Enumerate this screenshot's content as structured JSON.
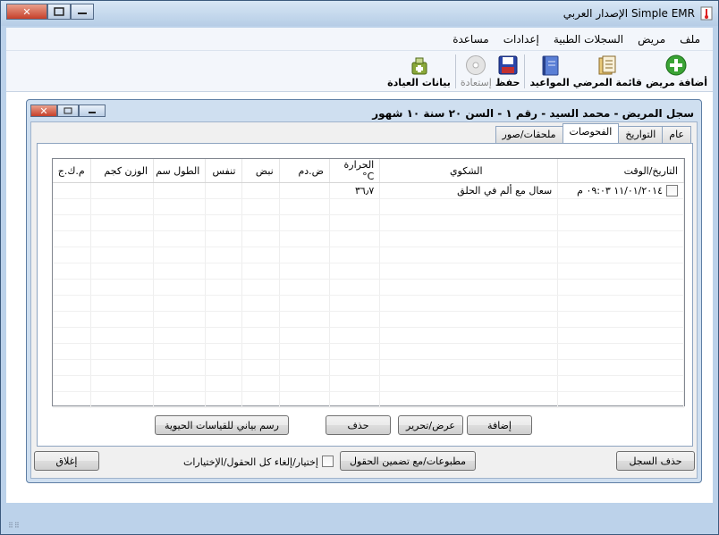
{
  "window": {
    "title": "Simple EMR الإصدار العربي",
    "controls": {
      "minimize": "",
      "maximize": "",
      "close": "✕"
    }
  },
  "menu": [
    "ملف",
    "مريض",
    "السجلات الطبية",
    "إعدادات",
    "مساعدة"
  ],
  "toolbar": {
    "items": [
      {
        "label": "أضافة مريض",
        "icon": "add-patient-icon"
      },
      {
        "label": "قائمة المرضي",
        "icon": "patient-list-icon"
      },
      {
        "label": "المواعيد",
        "icon": "appointments-icon"
      },
      {
        "label": "حفظ",
        "icon": "save-icon"
      },
      {
        "label": "إستعادة",
        "icon": "restore-icon",
        "disabled": true
      },
      {
        "label": "بيانات العيادة",
        "icon": "clinic-data-icon"
      }
    ]
  },
  "record": {
    "title": "سجل المريض - محمد السيد - رقم ١ - السن ٢٠ سنة ١٠ شهور",
    "tabs": [
      "عام",
      "التواريخ",
      "الفحوصات",
      "ملحقات/صور"
    ],
    "active_tab": 2,
    "table": {
      "columns": [
        "التاريخ/الوقت",
        "الشكوي",
        "الحرارة C°",
        "ض.دم",
        "نبض",
        "تنفس",
        "الطول سم",
        "الوزن كجم",
        "م.ك.ج"
      ],
      "rows": [
        [
          "١١/٠١/٢٠١٤ ٠٩:٠٣ م",
          "سعال مع ألم في الحلق",
          "٣٦٫٧",
          "",
          "",
          "",
          "",
          "",
          ""
        ]
      ]
    },
    "buttons": {
      "add": "إضافة",
      "view_edit": "عرض/تحرير",
      "delete": "حذف",
      "vitals_chart": "رسم بياني للقياسات الحيوية"
    },
    "footer": {
      "delete_record": "حذف السجل",
      "print": "مطبوعات/مع تضمين الحقول",
      "select_all_label": "إختيار/إلغاء كل الحقول/الإختيارات",
      "close": "إغلاق"
    }
  },
  "colors": {
    "add_icon": "#3aa335",
    "save_icon": "#2a45a8",
    "close_button": "#c6402a"
  }
}
